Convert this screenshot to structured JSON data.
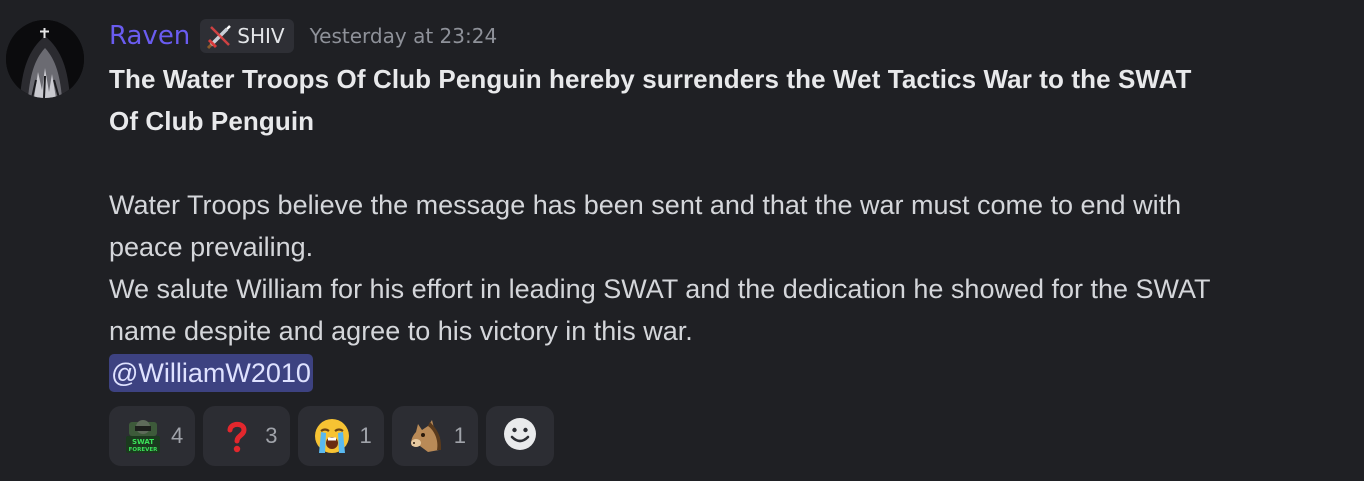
{
  "message": {
    "author": {
      "name": "Raven",
      "name_color": "#6a5cf0",
      "role_tag": "SHIV",
      "role_icon": "crossed-swords-icon"
    },
    "timestamp": "Yesterday at 23:24",
    "title_line1": "The Water Troops Of Club Penguin hereby surrenders the Wet Tactics War to the SWAT",
    "title_line2": "Of Club Penguin",
    "body_lines": [
      "Water Troops believe the message has been sent and that the war must come to end with",
      "peace prevailing.",
      "We salute William for his effort in leading SWAT and the dedication he showed for the SWAT",
      "name despite and agree to his victory in this war."
    ],
    "mention": "@WilliamW2010"
  },
  "reactions": [
    {
      "emoji": "swat-forever-custom-emoji",
      "count": "4"
    },
    {
      "emoji": "red-question-mark-emoji",
      "count": "3"
    },
    {
      "emoji": "loudly-crying-face-emoji",
      "count": "1"
    },
    {
      "emoji": "horse-face-emoji",
      "count": "1"
    }
  ],
  "add_reaction_icon": "add-reaction-smiley-icon"
}
